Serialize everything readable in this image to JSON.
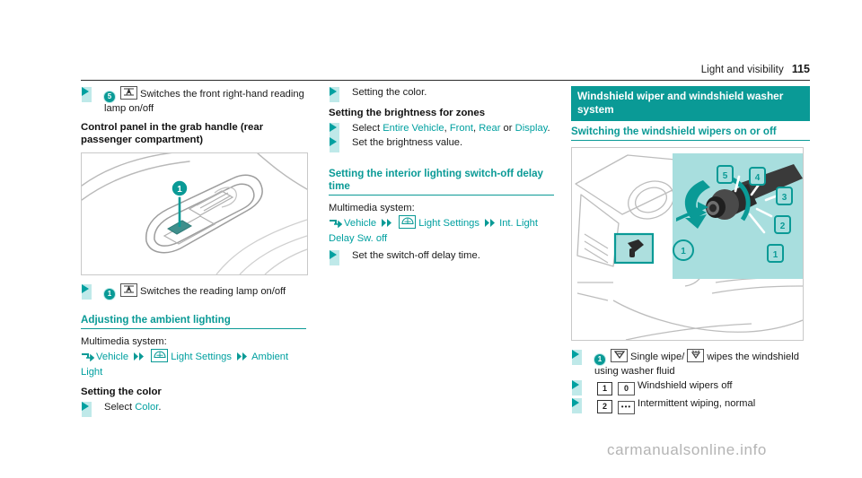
{
  "header": {
    "title": "Light and visibility",
    "page": "115"
  },
  "column1": {
    "bullet_reading_lamp_front": {
      "badge": "5",
      "icon": "reading-lamp-icon",
      "text": "Switches the front right-hand reading lamp on/off"
    },
    "heading_control_panel": "Control panel in the grab handle (rear passenger compartment)",
    "figure_caption": "grab-handle-control-panel-illustration",
    "figure_callout": "1",
    "bullet_reading_lamp": {
      "badge": "1",
      "icon": "reading-lamp-icon",
      "text": "Switches the reading lamp on/off"
    },
    "heading_ambient": "Adjusting the ambient lighting",
    "multimedia_label": "Multimedia system:",
    "mm_path": {
      "item1": "Vehicle",
      "icon": "light-settings-icon",
      "item2": "Light Settings",
      "item3": "Ambient Light"
    },
    "heading_setting_color": "Setting the color",
    "bullet_select_color_pre": "Select",
    "bullet_select_color_link": "Color",
    "bullet_select_color_post": "."
  },
  "column2": {
    "bullet_setting_color": "Setting the color.",
    "heading_brightness": "Setting the brightness for zones",
    "bullet_select_zones": {
      "pre": "Select",
      "opt1": "Entire Vehicle",
      "sep1": ",",
      "opt2": "Front",
      "sep2": ",",
      "opt3": "Rear",
      "or": "or",
      "opt4": "Display",
      "post": "."
    },
    "bullet_set_brightness": "Set the brightness value.",
    "heading_switchoff_delay": "Setting the interior lighting switch-off delay time",
    "multimedia_label": "Multimedia system:",
    "mm_path": {
      "item1": "Vehicle",
      "icon": "light-settings-icon",
      "item2": "Light Settings",
      "item3": "Int. Light Delay Sw. off"
    },
    "bullet_set_delay": "Set the switch-off delay time."
  },
  "column3": {
    "heading_main": "Windshield wiper and windshield washer system",
    "heading_sub": "Switching the windshield wipers on or off",
    "figure_caption": "wiper-stalk-illustration",
    "figure_callouts": [
      "1",
      "2",
      "3",
      "4",
      "5"
    ],
    "bullets": [
      {
        "badge": "1",
        "badge_style": "circle",
        "icon": "single-wipe-icon",
        "text_pre": "Single wipe/",
        "icon2": "washer-fluid-icon",
        "text_post": "wipes the windshield using washer fluid"
      },
      {
        "badge": "1",
        "badge_style": "square",
        "icon_label": "0",
        "text": "Windshield wipers off"
      },
      {
        "badge": "2",
        "badge_style": "square",
        "icon_label": "•••",
        "text": "Intermittent wiping, normal"
      }
    ]
  },
  "watermark": "carmanualsonline.info",
  "colors": {
    "teal_heading_bg": "#0a9a96",
    "teal_link": "#00a0a0",
    "bullet_block": "#bfe9e9",
    "figure_overlay": "#a8dede",
    "watermark": "#b4b4b4"
  }
}
